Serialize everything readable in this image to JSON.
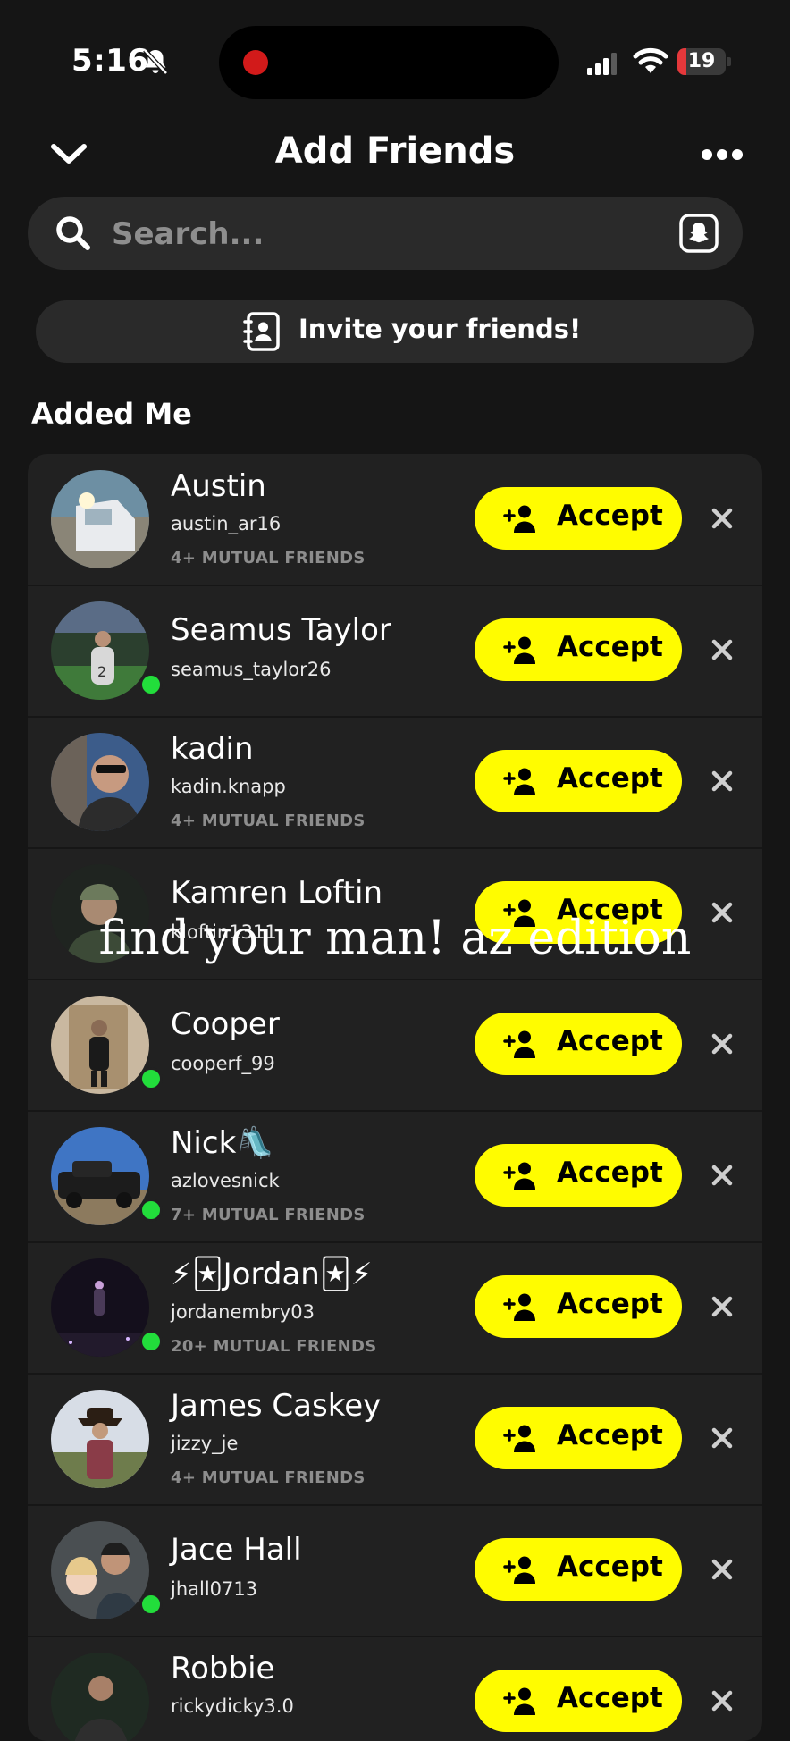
{
  "status": {
    "time": "5:16",
    "battery": "19",
    "battery_fraction": 0.19
  },
  "header": {
    "title": "Add Friends"
  },
  "search": {
    "placeholder": "Search..."
  },
  "invite": {
    "label": "Invite your friends!"
  },
  "section": {
    "title": "Added Me"
  },
  "accept_label": "Accept",
  "requests": [
    {
      "name": "Austin",
      "username": "austin_ar16",
      "mutual": "4+ MUTUAL FRIENDS",
      "online": false
    },
    {
      "name": "Seamus Taylor",
      "username": "seamus_taylor26",
      "mutual": "",
      "online": true
    },
    {
      "name": "kadin",
      "username": "kadin.knapp",
      "mutual": "4+ MUTUAL FRIENDS",
      "online": false
    },
    {
      "name": "Kamren Loftin",
      "username": "kloftin1311",
      "mutual": "",
      "online": false
    },
    {
      "name": "Cooper",
      "username": "cooperf_99",
      "mutual": "",
      "online": true
    },
    {
      "name": "Nick🛝",
      "username": "azlovesnick",
      "mutual": "7+ MUTUAL FRIENDS",
      "online": true
    },
    {
      "name": "⚡🃏Jordan🃏⚡",
      "username": "jordanembry03",
      "mutual": "20+ MUTUAL FRIENDS",
      "online": true
    },
    {
      "name": "James Caskey",
      "username": "jizzy_je",
      "mutual": "4+ MUTUAL FRIENDS",
      "online": false
    },
    {
      "name": "Jace Hall",
      "username": "jhall0713",
      "mutual": "",
      "online": true
    },
    {
      "name": "Robbie",
      "username": "rickydicky3.0",
      "mutual": "",
      "online": false
    }
  ],
  "overlay": {
    "caption": "find your man! az edition"
  },
  "colors": {
    "background": "#151515",
    "card": "#212121",
    "accent": "#fffc00",
    "online": "#22dd3b"
  }
}
